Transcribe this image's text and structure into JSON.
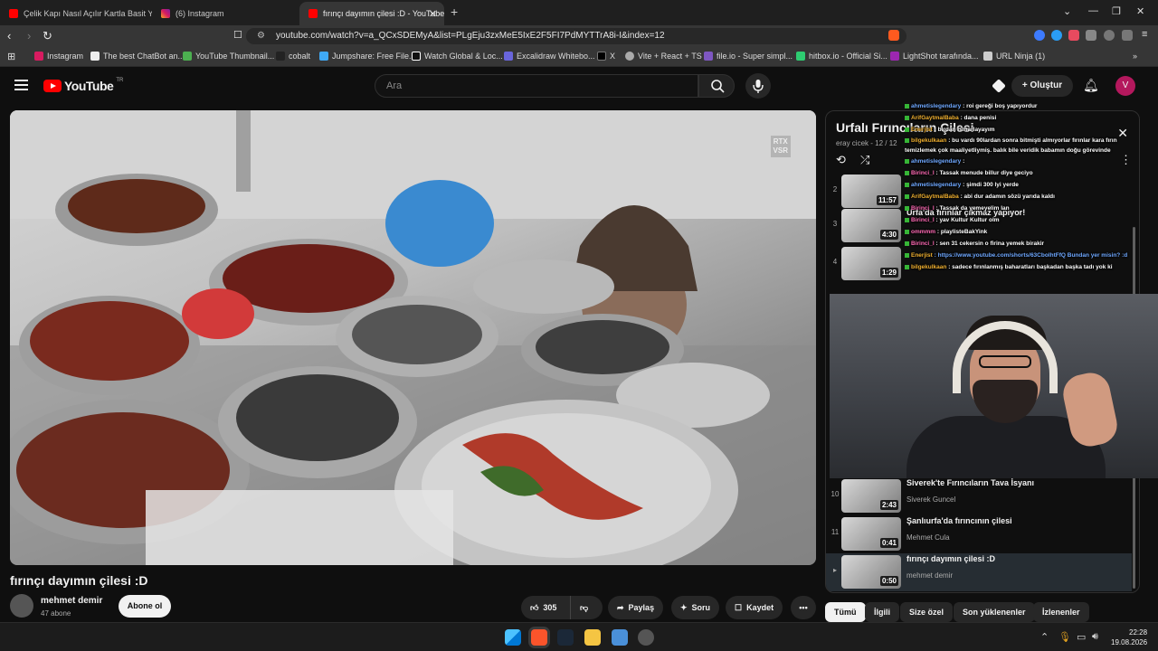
{
  "browser": {
    "tabs": [
      {
        "title": "Çelik Kapı Nasıl Açılır Kartla Basit Yön"
      },
      {
        "title": "(6) Instagram"
      },
      {
        "title": "fırınçı dayımın çilesi :D - YouTube"
      }
    ],
    "url": "youtube.com/watch?v=a_QCxSDEMyA&list=PLgEju3zxMeE5IxE2F5FI7PdMYTTrA8i-I&index=12",
    "bookmarks": [
      "Instagram",
      "The best ChatBot an...",
      "YouTube Thumbnail...",
      "cobalt",
      "Jumpshare: Free File...",
      "Watch Global & Loc...",
      "Excalidraw Whitebo...",
      "X",
      "Vite + React + TS",
      "file.io - Super simpl...",
      "hitbox.io - Official Si...",
      "LightShot tarafında...",
      "URL Ninja (1)"
    ]
  },
  "youtube": {
    "logo_text": "YouTube",
    "logo_region": "TR",
    "search_placeholder": "Ara",
    "create_label": "Oluştur",
    "avatar_letter": "V"
  },
  "video": {
    "overlay_badge_line1": "RTX",
    "overlay_badge_line2": "VSR",
    "title": "fırınçı dayımın çilesi :D",
    "channel": "mehmet demir",
    "subscribers": "47 abone",
    "subscribe_label": "Abone ol",
    "likes": "305",
    "share_label": "Paylaş",
    "ask_label": "Soru",
    "save_label": "Kaydet"
  },
  "playlist": {
    "title": "Urfalı Fırıncıların Çilesi",
    "subtitle": "eray cicek - 12 / 12",
    "items": [
      {
        "index": "2",
        "duration": "11:57",
        "name": "",
        "channel": ""
      },
      {
        "index": "3",
        "duration": "4:30",
        "name": "Urfa'da fırınlar çıkmaz yapıyor!",
        "channel": ""
      },
      {
        "index": "4",
        "duration": "1:29",
        "name": "",
        "channel": ""
      },
      {
        "index": "10",
        "duration": "2:43",
        "name": "Siverek'te Fırıncıların Tava İsyanı",
        "channel": "Siverek Guncel"
      },
      {
        "index": "11",
        "duration": "0:41",
        "name": "Şanlıurfa'da fırıncının çilesi",
        "channel": "Mehmet Cula"
      },
      {
        "index": "",
        "duration": "0:50",
        "name": "fırınçı dayımın çilesi :D",
        "channel": "mehmet demir"
      }
    ]
  },
  "chat": [
    {
      "user": "ahmetislegendary",
      "msg": ": roi gereği boş yapıyordur"
    },
    {
      "user": "ArifGaytmalBaba",
      "msg": ": dana penisi"
    },
    {
      "user": "Enerjist",
      "msg": ": birdan ısmarlayayım"
    },
    {
      "user": "bilgekulkaan",
      "msg": ": bu vardı 90lardan sonra bitmişti almıyorlar fırınlar kara fırın temizlemek çok maaliyetliymiş. balık bile veridik babamın doğu görevinde"
    },
    {
      "user": "ahmetislegendary",
      "msg": ":"
    },
    {
      "user": "Birinci_l",
      "msg": ": Tassak menude billur diye geciyo"
    },
    {
      "user": "ahmetislegendary",
      "msg": ": şimdi 300 lyi yerde"
    },
    {
      "user": "ArifGaytmalBaba",
      "msg": ": abi dur adamın sözü yarıda kaldı"
    },
    {
      "user": "Birinci_l",
      "msg": ": Tassak da yemeyelim lan"
    },
    {
      "user": "Birinci_l",
      "msg": ": yav Kultur Kultur olm"
    },
    {
      "user": "ommmm",
      "msg": ": playlisteBakYink"
    },
    {
      "user": "Birinci_l",
      "msg": ": sen 31 cekersin o firina yemek birakir"
    },
    {
      "user": "Enerjist",
      "msg": ": https://www.youtube.com/shorts/63CbolhtFfQ Bundan yer misin? :d"
    },
    {
      "user": "bilgekulkaan",
      "msg": ": sadece fırınlanmış baharatları başkadan başka tadı yok ki"
    }
  ],
  "chips": [
    "Tümü",
    "İlgili",
    "Size özel",
    "Son yüklenenler",
    "İzlenenler"
  ],
  "taskbar": {
    "time": "22:28",
    "date": "19.08.2026"
  },
  "colors": {
    "yt_red": "#ff0000",
    "background": "#0f0f0f",
    "chat_user_orange": "#f0b030",
    "chat_link_blue": "#6fa8ff"
  }
}
